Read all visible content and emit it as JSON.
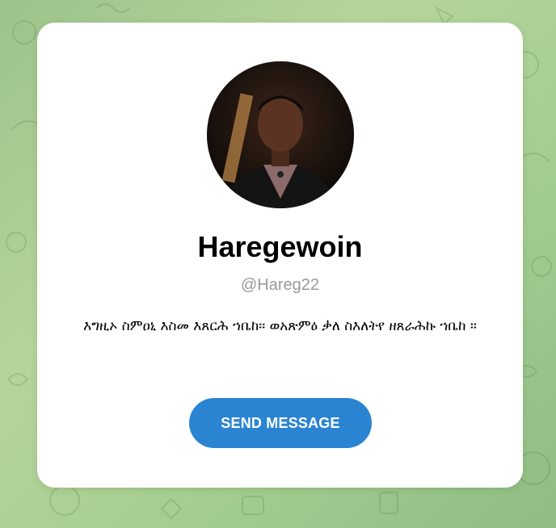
{
  "profile": {
    "display_name": "Haregewoin",
    "username": "@Hareg22",
    "bio": "እግዚኦ ስምዐኒ እስመ እጸርሕ ኀቤከ፡፡ ወአጽምዕ ቃለ ስእለትየ ዘጸራሕኩ ኀቤከ ።",
    "avatar_icon": "user-photo"
  },
  "actions": {
    "send_message_label": "SEND MESSAGE"
  },
  "colors": {
    "button": "#2b84d2",
    "username": "#9a9a9a",
    "background": "#9cc38a"
  }
}
